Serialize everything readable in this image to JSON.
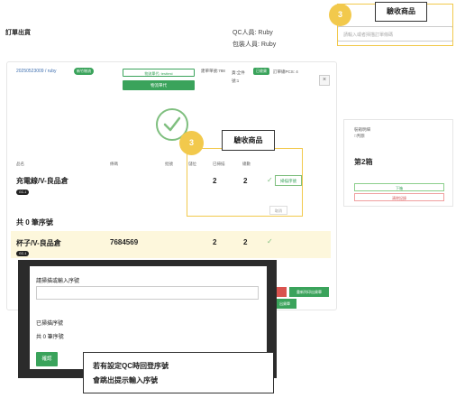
{
  "header": {
    "title": "訂單出貨",
    "qc_staff": "QC人員: Ruby",
    "packing_staff": "包裝人員: Ruby",
    "search_placeholder": "請輸入或者掃描訂單條碼"
  },
  "order": {
    "id": "20250523009 / ruby",
    "badge": "新竹物流",
    "logistics_input": "物流單代: testtest",
    "logistics_button": "物流單代",
    "order_date": "建單單號:788",
    "payment_line1": "貨:全件",
    "payment_line2": "號:1",
    "status": "已收貨",
    "order_count": "訂單總PCS: 4",
    "close": "×"
  },
  "table": {
    "headers": [
      "品名",
      "條碼",
      "批號",
      "儲位",
      "已掃描",
      "總數"
    ],
    "rows": [
      {
        "name": "充電線/V-良品倉",
        "barcode": "",
        "scanned": "2",
        "total": "2",
        "tag": "GC-1",
        "button": "掃描序號"
      },
      {
        "name": "杯子/V-良品倉",
        "barcode": "7684569",
        "scanned": "2",
        "total": "2",
        "tag": "GC-1"
      }
    ],
    "cancel_button": "取消",
    "serial_count": "共 0 筆序號"
  },
  "right_panel": {
    "setting_label": "裝箱明細",
    "checkbox_label": "□判斷",
    "box_title": "第2箱",
    "btn_next": "下箱",
    "btn_clear": "清除記錄"
  },
  "under_modal": {
    "reprint_button": "重新列印出貨單",
    "green_button2": "出貨單"
  },
  "callouts": {
    "step_number": "3",
    "top_label": "驗收商品",
    "mid_label": "驗收商品",
    "note_line1": "若有設定QC時回登序號",
    "note_line2": "會跳出提示輸入序號"
  },
  "modal": {
    "title": "請掃描或輸入序號",
    "scanned_label": "已掃描序號",
    "serial_count": "共 0 筆序號",
    "confirm_button": "確認"
  },
  "colors": {
    "accent_green": "#3aa35b",
    "highlight_yellow": "#f2c94c",
    "row_highlight": "#fdf7dc",
    "modal_frame": "#2b2b2b"
  }
}
